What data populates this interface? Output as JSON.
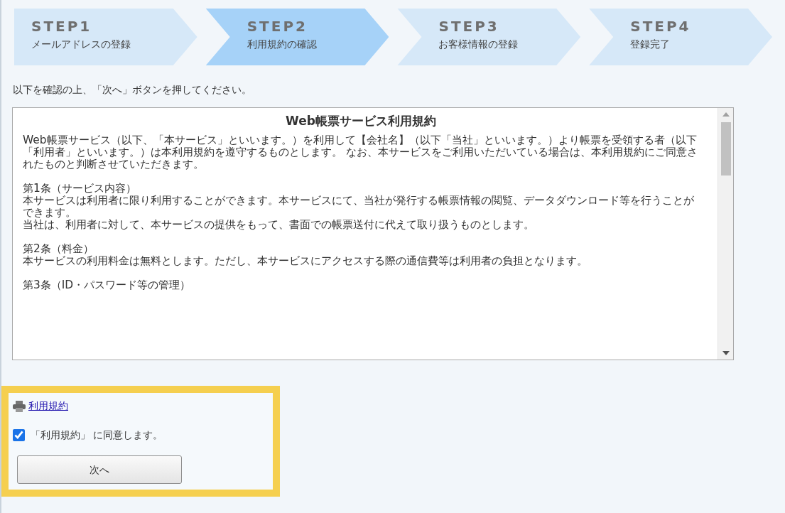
{
  "steps": [
    {
      "label": "STEP1",
      "title": "メールアドレスの登録",
      "selected": false
    },
    {
      "label": "STEP2",
      "title": "利用規約の確認",
      "selected": true
    },
    {
      "label": "STEP3",
      "title": "お客様情報の登録",
      "selected": false
    },
    {
      "label": "STEP4",
      "title": "登録完了",
      "selected": false
    }
  ],
  "instruction": "以下を確認の上、「次へ」ボタンを押してください。",
  "terms": {
    "title": "Web帳票サービス利用規約",
    "sections": [
      {
        "lines": [
          "Web帳票サービス（以下、「本サービス」といいます。）を利用して【会社名】（以下「当社」といいます。）より帳票を受領する者（以下「利用者」といいます。）は本利用規約を遵守するものとします。 なお、本サービスをご利用いただいている場合は、本利用規約にご同意されたものと判断させていただきます。"
        ]
      },
      {
        "heading": "第1条（サービス内容）",
        "lines": [
          "本サービスは利用者に限り利用することができます。本サービスにて、当社が発行する帳票情報の閲覧、データダウンロード等を行うことができます。",
          "当社は、利用者に対して、本サービスの提供をもって、書面での帳票送付に代えて取り扱うものとします。"
        ]
      },
      {
        "heading": "第2条（料金）",
        "lines": [
          "本サービスの利用料金は無料とします。ただし、本サービスにアクセスする際の通信費等は利用者の負担となります。"
        ]
      },
      {
        "heading": "第3条（ID・パスワード等の管理）"
      }
    ]
  },
  "print_link": "利用規約",
  "agree": {
    "label": "「利用規約」 に同意します。",
    "checked": true
  },
  "next_button": "次へ"
}
